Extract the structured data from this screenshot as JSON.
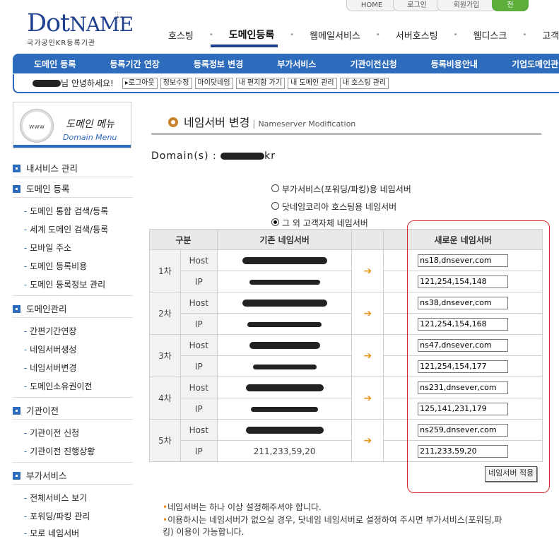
{
  "top_links": [
    "HOME",
    "로그인",
    "회원가입",
    "전"
  ],
  "logo": {
    "main": "Dot",
    "main2": "NAME",
    "sub": "국가공인KR등록기관"
  },
  "main_nav": [
    "호스팅",
    "도메인등록",
    "웹메일서비스",
    "서버호스팅",
    "웹디스크",
    "고객서"
  ],
  "sub_nav": [
    "도메인 등록",
    "등록기간 연장",
    "등록정보 변경",
    "부가서비스",
    "기관이전신청",
    "등록비용안내",
    "기업도메인관"
  ],
  "greeting": {
    "text": "님 안녕하세요!",
    "buttons": [
      "▸로그아웃",
      "정보수정",
      "마이닷네임",
      "내 편지함 가기",
      "내 도메인 관리",
      "내 호스팅 관리"
    ]
  },
  "side_menu": {
    "title": "도메인 메뉴",
    "subtitle": "Domain Menu",
    "logo_text": "www",
    "items": [
      {
        "label": "내서비스 관리",
        "level": 1
      },
      {
        "label": "도메인 등록",
        "level": 1
      },
      {
        "label": "도메인 통합 검색/등록",
        "level": 2
      },
      {
        "label": "세계 도메인 검색/등록",
        "level": 2
      },
      {
        "label": "모바일 주소",
        "level": 2
      },
      {
        "label": "도메인 등록비용",
        "level": 2
      },
      {
        "label": "도메인 등록정보 관리",
        "level": 2
      },
      {
        "label": "도메인관리",
        "level": 1
      },
      {
        "label": "간편기간연장",
        "level": 2
      },
      {
        "label": "네임서버생성",
        "level": 2
      },
      {
        "label": "네임서버변경",
        "level": 2
      },
      {
        "label": "도메인소유권이전",
        "level": 2
      },
      {
        "label": "기관이전",
        "level": 1
      },
      {
        "label": "기관이전 신청",
        "level": 2
      },
      {
        "label": "기관이전 진행상황",
        "level": 2
      },
      {
        "label": "부가서비스",
        "level": 1
      },
      {
        "label": "전체서비스 보기",
        "level": 2
      },
      {
        "label": "포워딩/파킹 관리",
        "level": 2
      },
      {
        "label": "모로 네임서버",
        "level": 2
      }
    ]
  },
  "page": {
    "title": "네임서버 변경",
    "subtitle": "Nameserver Modification",
    "domain_label": "Domain(s) :",
    "domain_suffix": "kr"
  },
  "radios": [
    {
      "label": "부가서비스(포워딩/파킹)용 네임서버",
      "selected": false
    },
    {
      "label": "닷네임코리아 호스팅용 네임서버",
      "selected": false
    },
    {
      "label": "그 외 고객자체 네임서버",
      "selected": true
    }
  ],
  "table": {
    "headers": [
      "구분",
      "기존 네임서버",
      "새로운 네임서버"
    ],
    "host_label": "Host",
    "ip_label": "IP",
    "rows": [
      {
        "order": "1차",
        "new_host": "ns18,dnsever,com",
        "new_ip": "121,254,154,148"
      },
      {
        "order": "2차",
        "new_host": "ns38,dnsever,com",
        "new_ip": "121,254,154,168"
      },
      {
        "order": "3차",
        "new_host": "ns47,dnsever,com",
        "new_ip": "121,254,154,177"
      },
      {
        "order": "4차",
        "new_host": "ns231,dnsever,com",
        "new_ip": "125,141,231,179"
      },
      {
        "order": "5차",
        "new_host": "ns259,dnsever,com",
        "new_ip": "211,233,59,20"
      }
    ],
    "old_ip_5": "211,233,59,20"
  },
  "apply_button": "네임서버 적용",
  "notes": [
    "네임서버는 하나 이상 설정해주셔야 합니다.",
    "이용하시는 네임서버가 없으실 경우, 닷네임 네임서버로 설정하여 주시면 부가서비스(포워딩,파",
    "킹) 이용이 가능합니다."
  ],
  "colors": {
    "brand_blue": "#2d6bbd",
    "accent_orange": "#e8941a",
    "highlight_red": "#d32a2a"
  }
}
